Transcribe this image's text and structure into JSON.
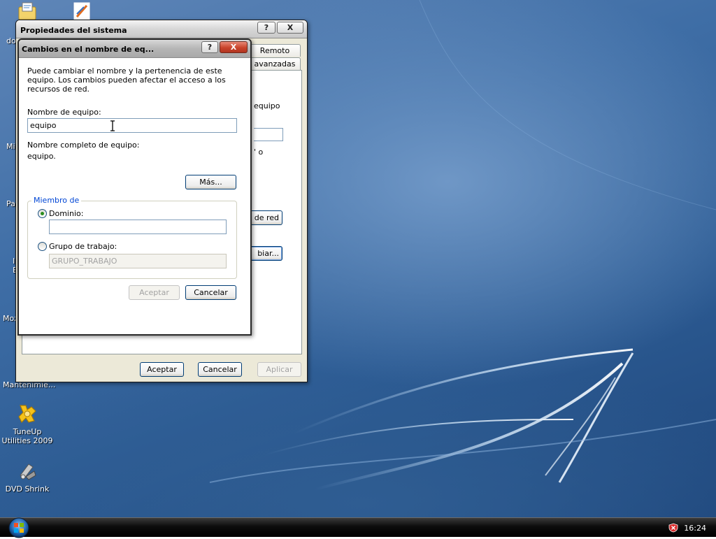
{
  "desktop": {
    "icons": [
      {
        "label": "TuneUp Utilities 2009",
        "icon": "tuneup-icon"
      },
      {
        "label": "DVD Shrink",
        "icon": "dvd-shrink-icon"
      }
    ],
    "partial_labels": [
      "do",
      "Mis",
      "Pa",
      "I",
      "E",
      "Moz",
      "Mantenimie..."
    ]
  },
  "system_properties": {
    "title": "Propiedades del sistema",
    "tabs": [
      "Remoto",
      "avanzadas"
    ],
    "partial_texts": [
      "equipo",
      "' o"
    ],
    "partial_buttons": [
      "de red",
      "biar..."
    ],
    "buttons": {
      "ok": "Aceptar",
      "cancel": "Cancelar",
      "apply": "Aplicar"
    },
    "help_label": "?",
    "close_label": "X"
  },
  "rename_dialog": {
    "title": "Cambios en el nombre de eq...",
    "help_label": "?",
    "close_label": "X",
    "description": "Puede cambiar el nombre y la pertenencia de este equipo. Los cambios pueden afectar el acceso a los recursos de red.",
    "computer_name_label": "Nombre de equipo:",
    "computer_name_value": "equipo",
    "full_name_label": "Nombre completo de equipo:",
    "full_name_value": "equipo.",
    "more_button": "Más...",
    "member_of_label": "Miembro de",
    "domain_label": "Dominio:",
    "domain_value": "",
    "domain_selected": true,
    "workgroup_label": "Grupo de trabajo:",
    "workgroup_value": "GRUPO_TRABAJO",
    "ok_button": "Aceptar",
    "cancel_button": "Cancelar"
  },
  "taskbar": {
    "clock": "16:24"
  },
  "colors": {
    "accent": "#0046d5",
    "close_button": "#c9442b",
    "radio_selected": "#2b8d1d"
  }
}
